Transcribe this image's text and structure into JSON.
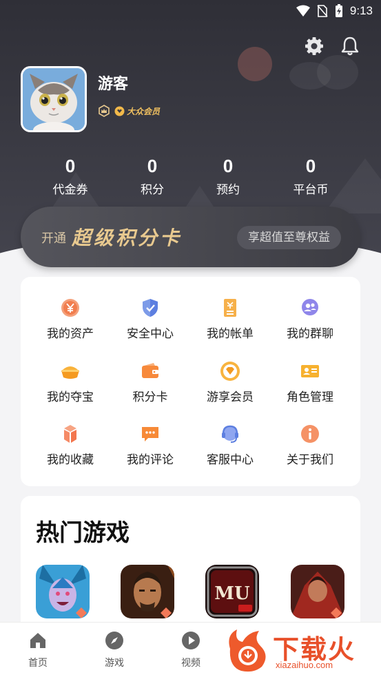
{
  "status": {
    "time": "9:13"
  },
  "profile": {
    "name": "游客",
    "vip_label": "大众会员"
  },
  "stats": [
    {
      "value": "0",
      "label": "代金券"
    },
    {
      "value": "0",
      "label": "积分"
    },
    {
      "value": "0",
      "label": "预约"
    },
    {
      "value": "0",
      "label": "平台币"
    }
  ],
  "banner": {
    "open": "开通",
    "title": "超级积分卡",
    "button": "享超值至尊权益"
  },
  "menu": {
    "items": [
      {
        "label": "我的资产",
        "icon": "yen-coin-icon"
      },
      {
        "label": "安全中心",
        "icon": "shield-check-icon"
      },
      {
        "label": "我的帐单",
        "icon": "bill-icon"
      },
      {
        "label": "我的群聊",
        "icon": "group-chat-icon"
      },
      {
        "label": "我的夺宝",
        "icon": "treasure-icon"
      },
      {
        "label": "积分卡",
        "icon": "wallet-icon"
      },
      {
        "label": "游享会员",
        "icon": "vip-diamond-icon"
      },
      {
        "label": "角色管理",
        "icon": "id-card-icon"
      },
      {
        "label": "我的收藏",
        "icon": "favorites-box-icon"
      },
      {
        "label": "我的评论",
        "icon": "comment-icon"
      },
      {
        "label": "客服中心",
        "icon": "headset-icon"
      },
      {
        "label": "关于我们",
        "icon": "info-icon"
      }
    ]
  },
  "games": {
    "title": "热门游戏"
  },
  "nav": {
    "items": [
      {
        "label": "首页",
        "icon": "home-icon"
      },
      {
        "label": "游戏",
        "icon": "compass-icon"
      },
      {
        "label": "视频",
        "icon": "play-icon"
      }
    ]
  },
  "watermark": {
    "text": "下载火",
    "sub": "xiazaihuo.com"
  },
  "colors": {
    "header_bg": "#34343c",
    "accent_orange": "#f48d3c",
    "gold": "#e8c98f",
    "blue": "#6b8fe6"
  }
}
